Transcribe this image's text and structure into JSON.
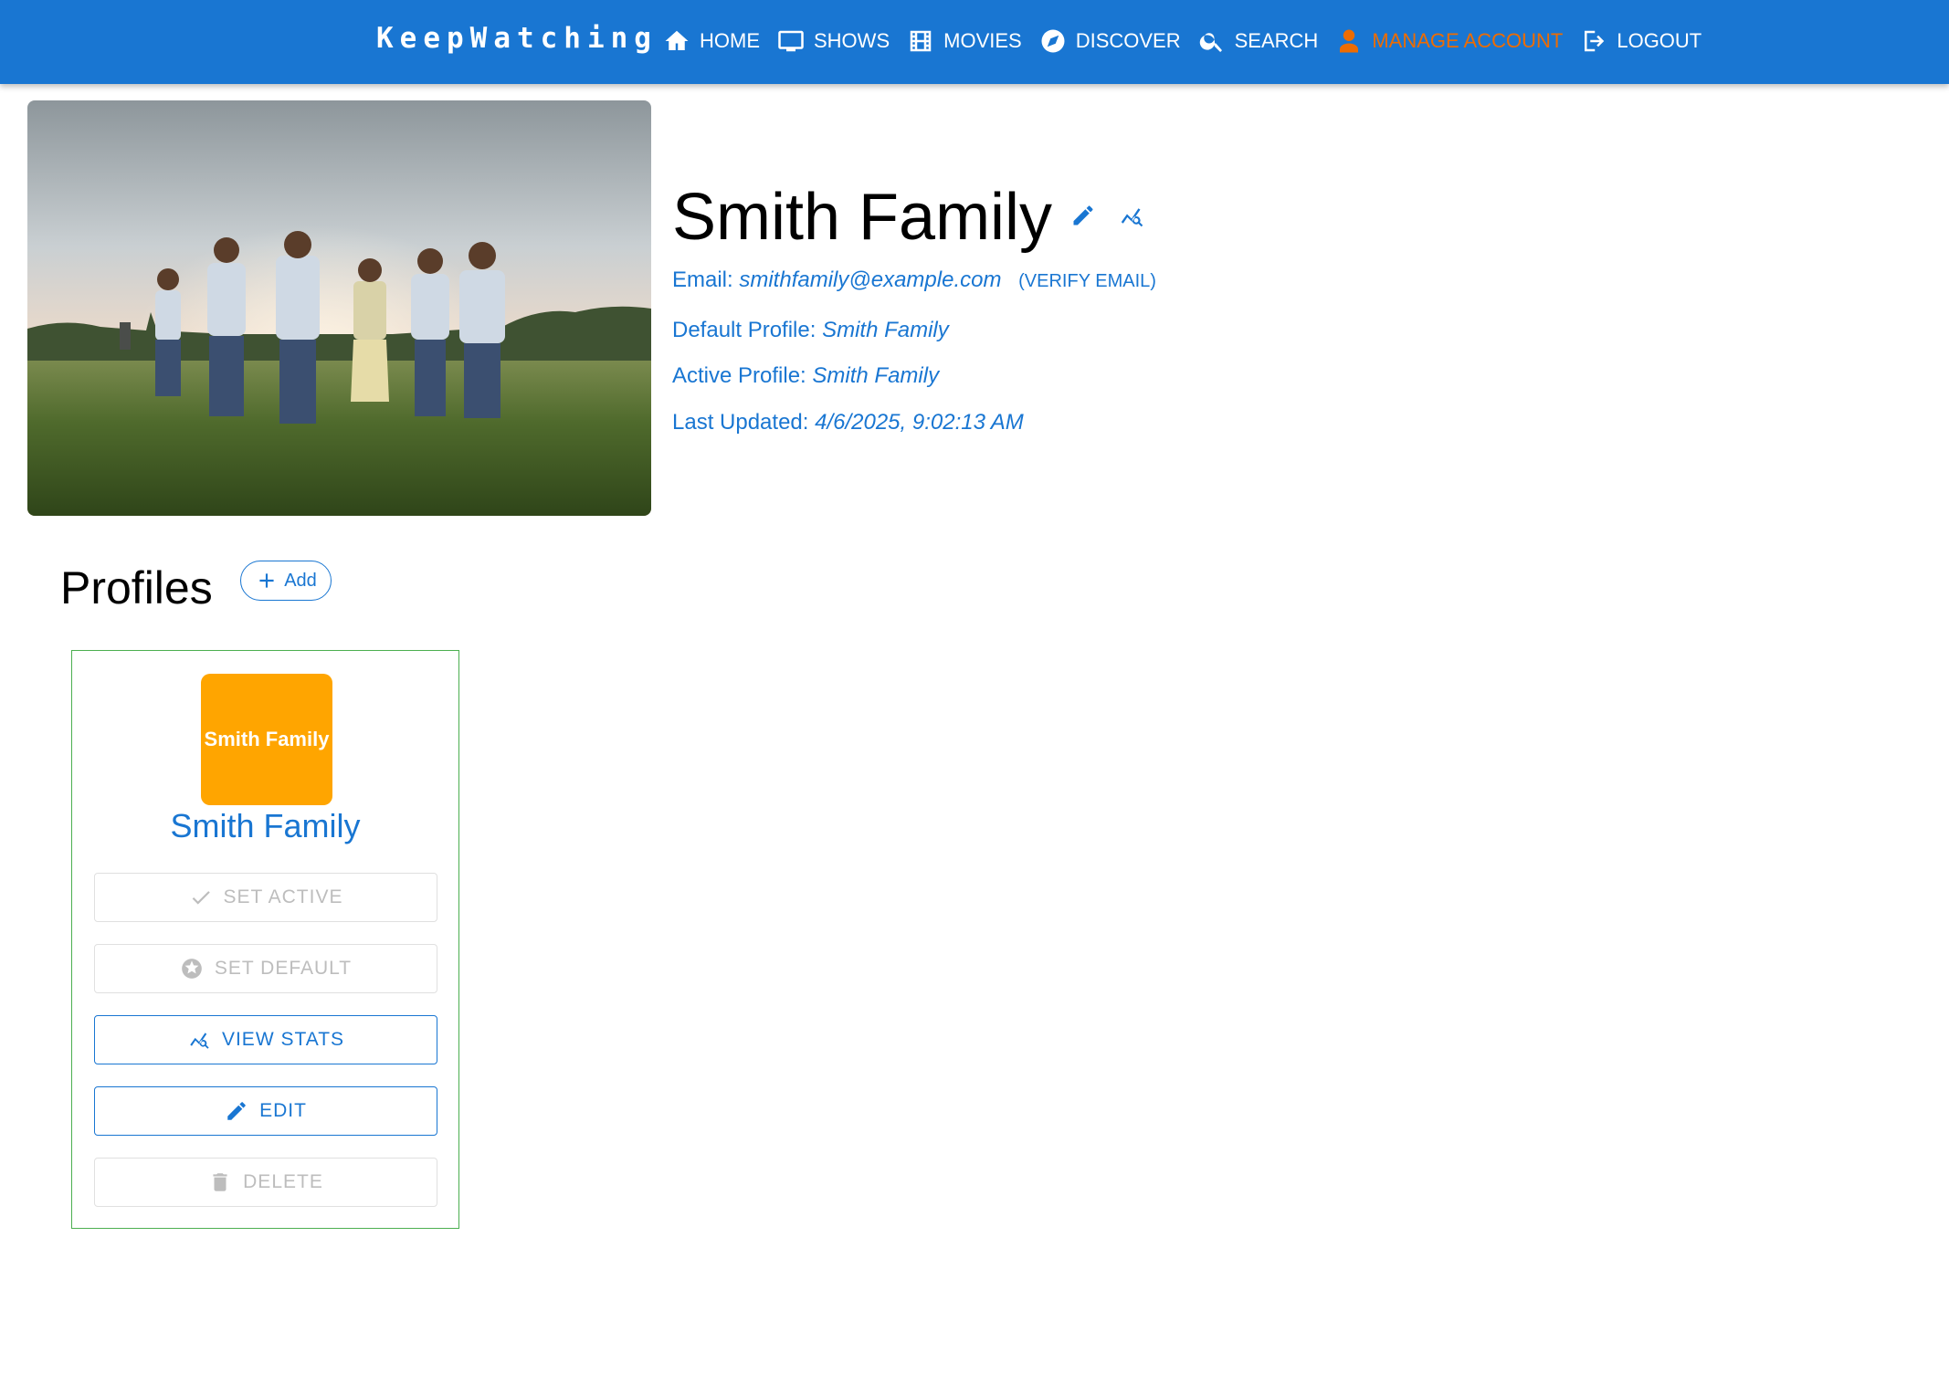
{
  "brand": "KeepWatching",
  "nav": {
    "home": "HOME",
    "shows": "SHOWS",
    "movies": "MOVIES",
    "discover": "DISCOVER",
    "search": "SEARCH",
    "manage_account": "MANAGE ACCOUNT",
    "logout": "LOGOUT"
  },
  "account": {
    "name": "Smith Family",
    "email_label": "Email:",
    "email": "smithfamily@example.com",
    "verify_label": "(VERIFY EMAIL)",
    "default_profile_label": "Default Profile:",
    "default_profile": "Smith Family",
    "active_profile_label": "Active Profile:",
    "active_profile": "Smith Family",
    "last_updated_label": "Last Updated:",
    "last_updated": "4/6/2025, 9:02:13 AM"
  },
  "profiles": {
    "heading": "Profiles",
    "add_label": "Add",
    "items": [
      {
        "avatar_text": "Smith Family",
        "name": "Smith Family",
        "set_active_label": "SET ACTIVE",
        "set_default_label": "SET DEFAULT",
        "view_stats_label": "VIEW STATS",
        "edit_label": "EDIT",
        "delete_label": "DELETE"
      }
    ]
  },
  "colors": {
    "primary": "#1976d2",
    "active_nav": "#ed6c02",
    "avatar_bg": "#ffa500",
    "card_border": "#4caf50",
    "disabled": "#bdbdbd"
  },
  "icons": [
    "home-icon",
    "tv-icon",
    "film-icon",
    "compass-icon",
    "search-icon",
    "person-icon",
    "logout-icon",
    "pencil-icon",
    "stats-icon",
    "plus-icon",
    "check-icon",
    "star-circle-icon",
    "trash-icon"
  ]
}
